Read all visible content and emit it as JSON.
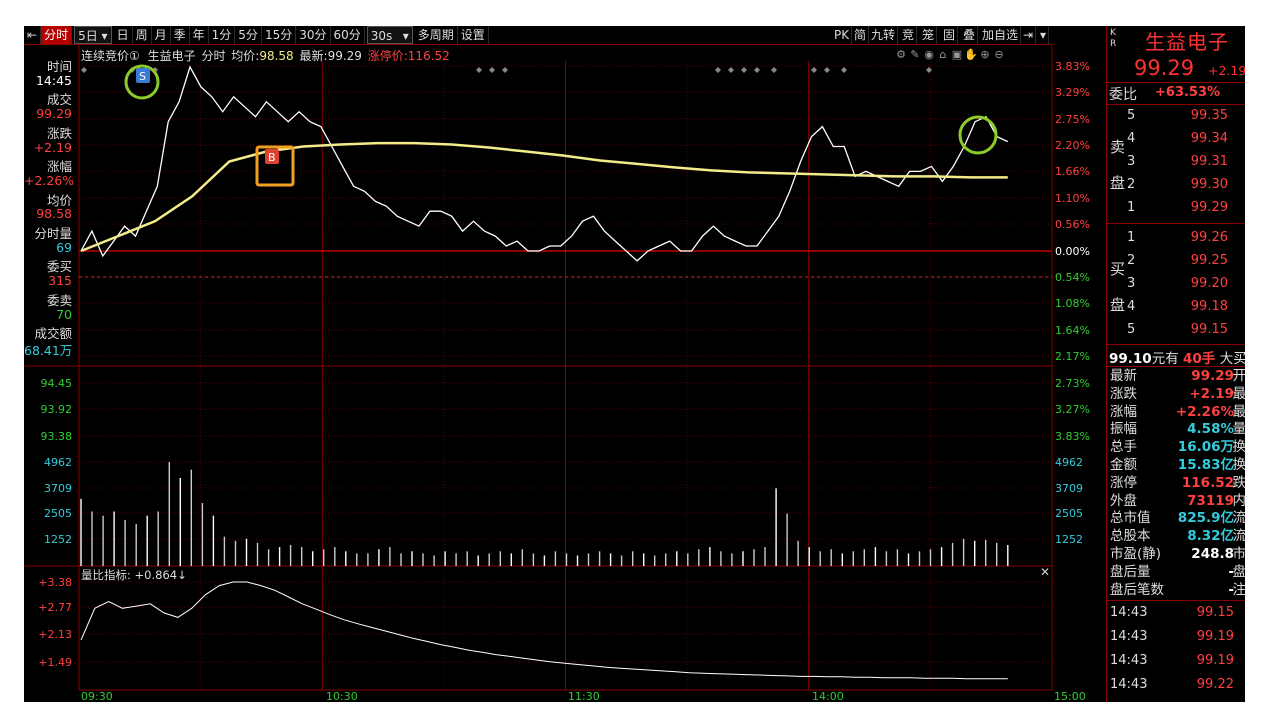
{
  "toolbar": {
    "items": [
      "分时",
      "5日",
      "日",
      "周",
      "月",
      "季",
      "年",
      "1分",
      "5分",
      "15分",
      "30分",
      "60分",
      "30s",
      "多周期",
      "设置"
    ],
    "right": [
      "PK",
      "简",
      "九转",
      "竞",
      "笼",
      "固",
      "叠",
      "加自选"
    ]
  },
  "chart_header": {
    "auction_label": "连续竞价①",
    "name": "生益电子",
    "mode": "分时",
    "avg_label": "均价:",
    "avg_value": "98.58",
    "latest_label": "最新:",
    "latest_value": "99.29",
    "limit_label": "涨停价:",
    "limit_value": "116.52"
  },
  "left_info": [
    {
      "t": "时间",
      "c": "lbl"
    },
    {
      "t": "14:45",
      "c": "wht"
    },
    {
      "t": "成交",
      "c": "lbl"
    },
    {
      "t": "99.29",
      "c": "red"
    },
    {
      "t": "涨跌",
      "c": "lbl"
    },
    {
      "t": "+2.19",
      "c": "red"
    },
    {
      "t": "涨幅",
      "c": "lbl"
    },
    {
      "t": "+2.26%",
      "c": "red"
    },
    {
      "t": "均价",
      "c": "lbl"
    },
    {
      "t": "98.58",
      "c": "red"
    },
    {
      "t": "分时量",
      "c": "lbl"
    },
    {
      "t": "69",
      "c": "cyan"
    },
    {
      "t": "委买",
      "c": "lbl"
    },
    {
      "t": "315",
      "c": "red"
    },
    {
      "t": "委卖",
      "c": "lbl"
    },
    {
      "t": "70",
      "c": "grn"
    },
    {
      "t": "成交额",
      "c": "lbl"
    },
    {
      "t": "68.41万",
      "c": "cyan"
    }
  ],
  "price_axis_left": [
    "94.45",
    "93.92",
    "93.38"
  ],
  "pct_axis": [
    {
      "t": "3.83%",
      "c": "red"
    },
    {
      "t": "3.29%",
      "c": "red"
    },
    {
      "t": "2.75%",
      "c": "red"
    },
    {
      "t": "2.20%",
      "c": "red"
    },
    {
      "t": "1.66%",
      "c": "red"
    },
    {
      "t": "1.10%",
      "c": "red"
    },
    {
      "t": "0.56%",
      "c": "red"
    },
    {
      "t": "0.00%",
      "c": "wht"
    },
    {
      "t": "0.54%",
      "c": "grn"
    },
    {
      "t": "1.08%",
      "c": "grn"
    },
    {
      "t": "1.64%",
      "c": "grn"
    },
    {
      "t": "2.17%",
      "c": "grn"
    },
    {
      "t": "2.73%",
      "c": "grn"
    },
    {
      "t": "3.27%",
      "c": "grn"
    },
    {
      "t": "3.83%",
      "c": "grn"
    }
  ],
  "volume_axis": [
    "4962",
    "3709",
    "2505",
    "1252"
  ],
  "ratio_indicator": {
    "label": "量比指标: +0.864↓",
    "axis": [
      "+3.38",
      "+2.77",
      "+2.13",
      "+1.49"
    ]
  },
  "time_axis": [
    "09:30",
    "10:30",
    "11:30",
    "14:00",
    "15:00"
  ],
  "markers": {
    "sell": "S",
    "buy": "B"
  },
  "right_panel": {
    "code_letters": "K R",
    "stock_name": "生益电子",
    "price": "99.29",
    "change": "+2.19",
    "weibi_label": "委比",
    "weibi_value": "+63.53%",
    "sell_label": [
      "卖",
      "盘"
    ],
    "buy_label": [
      "买",
      "盘"
    ],
    "asks": [
      {
        "n": "5",
        "p": "99.35"
      },
      {
        "n": "4",
        "p": "99.34"
      },
      {
        "n": "3",
        "p": "99.31"
      },
      {
        "n": "2",
        "p": "99.30"
      },
      {
        "n": "1",
        "p": "99.29"
      }
    ],
    "bids": [
      {
        "n": "1",
        "p": "99.26"
      },
      {
        "n": "2",
        "p": "99.25"
      },
      {
        "n": "3",
        "p": "99.20"
      },
      {
        "n": "4",
        "p": "99.18"
      },
      {
        "n": "5",
        "p": "99.15"
      }
    ],
    "big_order": {
      "price": "99.10",
      "unit": "元有",
      "qty": "40手",
      "tail": "大买"
    },
    "stats": [
      {
        "k": "最新",
        "v": "99.29",
        "c": "red",
        "t": "开"
      },
      {
        "k": "涨跌",
        "v": "+2.19",
        "c": "red",
        "t": "最"
      },
      {
        "k": "涨幅",
        "v": "+2.26%",
        "c": "red",
        "t": "最"
      },
      {
        "k": "振幅",
        "v": "4.58%",
        "c": "cyan",
        "t": "量"
      },
      {
        "k": "总手",
        "v": "16.06万",
        "c": "cyan",
        "t": "换"
      },
      {
        "k": "金额",
        "v": "15.83亿",
        "c": "cyan",
        "t": "换"
      },
      {
        "k": "涨停",
        "v": "116.52",
        "c": "red",
        "t": "跌"
      },
      {
        "k": "外盘",
        "v": "73119",
        "c": "red",
        "t": "内"
      },
      {
        "k": "总市值",
        "v": "825.9亿",
        "c": "cyan",
        "t": "流"
      },
      {
        "k": "总股本",
        "v": "8.32亿",
        "c": "cyan",
        "t": "流"
      },
      {
        "k": "市盈(静)",
        "v": "248.8",
        "c": "wht",
        "t": "市"
      },
      {
        "k": "盘后量",
        "v": "-",
        "c": "wht",
        "t": "盘"
      },
      {
        "k": "盘后笔数",
        "v": "-",
        "c": "wht",
        "t": "注"
      }
    ],
    "ticks": [
      {
        "tm": "14:43",
        "p": "99.15"
      },
      {
        "tm": "14:43",
        "p": "99.19"
      },
      {
        "tm": "14:43",
        "p": "99.19"
      },
      {
        "tm": "14:43",
        "p": "99.22"
      }
    ]
  },
  "chart_data": {
    "type": "line",
    "x_range": [
      "09:30",
      "15:00"
    ],
    "pct_range": [
      -3.83,
      3.83
    ],
    "price": [
      97.1,
      97.5,
      97.0,
      97.3,
      97.6,
      97.4,
      97.9,
      98.4,
      99.7,
      100.1,
      100.8,
      100.4,
      100.2,
      99.9,
      100.2,
      100.0,
      99.8,
      100.1,
      99.9,
      99.7,
      99.9,
      99.7,
      99.6,
      99.2,
      98.8,
      98.4,
      98.3,
      98.1,
      98.0,
      97.8,
      97.7,
      97.6,
      97.9,
      97.9,
      97.8,
      97.5,
      97.7,
      97.5,
      97.4,
      97.2,
      97.3,
      97.1,
      97.1,
      97.2,
      97.2,
      97.4,
      97.7,
      97.8,
      97.5,
      97.3,
      97.1,
      96.9,
      97.1,
      97.2,
      97.3,
      97.1,
      97.1,
      97.4,
      97.6,
      97.4,
      97.3,
      97.2,
      97.2,
      97.5,
      97.8,
      98.3,
      98.9,
      99.4,
      99.6,
      99.2,
      99.2,
      98.6,
      98.7,
      98.6,
      98.5,
      98.4,
      98.7,
      98.7,
      98.8,
      98.5,
      98.8,
      99.2,
      99.7,
      99.8,
      99.4,
      99.3
    ],
    "avg": [
      97.1,
      97.4,
      97.7,
      98.2,
      98.9,
      99.1,
      99.2,
      99.24,
      99.27,
      99.27,
      99.24,
      99.18,
      99.1,
      99.02,
      98.92,
      98.85,
      98.78,
      98.72,
      98.68,
      98.66,
      98.64,
      98.62,
      98.6,
      98.6,
      98.58,
      98.58
    ],
    "volume": [
      3200,
      2600,
      2400,
      2600,
      2200,
      2000,
      2400,
      2600,
      4962,
      4200,
      4600,
      3000,
      2400,
      1400,
      1200,
      1300,
      1100,
      800,
      900,
      1000,
      900,
      700,
      800,
      900,
      700,
      600,
      600,
      800,
      900,
      600,
      700,
      600,
      500,
      700,
      600,
      700,
      500,
      600,
      700,
      600,
      800,
      600,
      500,
      700,
      600,
      500,
      600,
      700,
      600,
      500,
      700,
      600,
      500,
      600,
      700,
      600,
      800,
      900,
      700,
      600,
      700,
      800,
      900,
      3709,
      2500,
      1200,
      900,
      700,
      800,
      600,
      700,
      800,
      900,
      700,
      800,
      600,
      700,
      800,
      900,
      1100,
      1300,
      1200,
      1252,
      1100,
      1000
    ],
    "volume_ratio": [
      2.1,
      2.8,
      2.95,
      2.8,
      2.85,
      2.9,
      2.7,
      2.6,
      2.8,
      3.1,
      3.3,
      3.38,
      3.38,
      3.3,
      3.2,
      3.05,
      2.9,
      2.78,
      2.66,
      2.55,
      2.46,
      2.38,
      2.3,
      2.22,
      2.14,
      2.07,
      2.0,
      1.94,
      1.88,
      1.83,
      1.78,
      1.74,
      1.7,
      1.66,
      1.62,
      1.59,
      1.56,
      1.53,
      1.5,
      1.48,
      1.46,
      1.44,
      1.42,
      1.4,
      1.38,
      1.37,
      1.36,
      1.35,
      1.34,
      1.33,
      1.32,
      1.31,
      1.3,
      1.3,
      1.29,
      1.29,
      1.28,
      1.28,
      1.27,
      1.27,
      1.27,
      1.26,
      1.26,
      1.26,
      1.25,
      1.25,
      1.25,
      1.25
    ],
    "prev_close": 97.1,
    "colors": {
      "price": "#ffffff",
      "avg": "#f2ec8a",
      "up_grid": "#8a0000",
      "marker_ring_green": "#8ccc2a",
      "marker_ring_orange": "#f0a020"
    }
  }
}
